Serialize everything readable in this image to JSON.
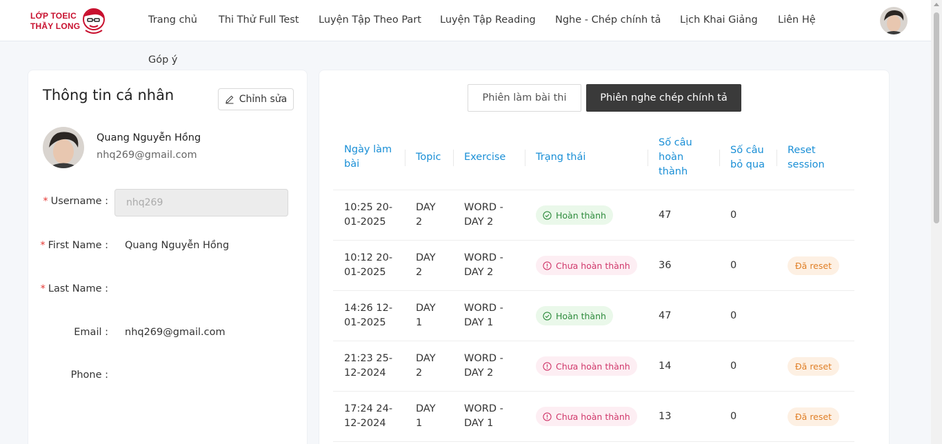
{
  "header": {
    "logo_text_line1": "LỚP TOEIC",
    "logo_text_line2": "THẦY LONG",
    "nav": [
      "Trang chủ",
      "Thi Thử Full Test",
      "Luyện Tập Theo Part",
      "Luyện Tập Reading",
      "Nghe - Chép chính tả",
      "Lịch Khai Giảng",
      "Liên Hệ",
      "Góp ý"
    ],
    "avatar_icon": "user-avatar"
  },
  "profile": {
    "title": "Thông tin cá nhân",
    "edit_label": "Chỉnh sửa",
    "edit_icon": "pencil-icon",
    "name": "Quang Nguyễn Hồng",
    "email": "nhq269@gmail.com",
    "fields": {
      "username_label": "Username",
      "username_value": "nhq269",
      "first_name_label": "First Name",
      "first_name_value": "Quang Nguyễn Hồng",
      "last_name_label": "Last Name",
      "last_name_value": "",
      "email_label": "Email",
      "email_value": "nhq269@gmail.com",
      "phone_label": "Phone",
      "phone_value": ""
    }
  },
  "tabs": {
    "tab1": "Phiên làm bài thi",
    "tab2": "Phiên nghe chép chính tả",
    "active": "tab2"
  },
  "table": {
    "columns": {
      "date": [
        "Ngày làm",
        "bài"
      ],
      "topic": [
        "Topic"
      ],
      "exercise": [
        "Exercise"
      ],
      "status": [
        "Trạng thái"
      ],
      "completed": [
        "Số câu",
        "hoàn",
        "thành"
      ],
      "skipped": [
        "Số câu",
        "bỏ qua"
      ],
      "reset": [
        "Reset",
        "session"
      ]
    },
    "rows": [
      {
        "date": [
          "10:25 20-",
          "01-2025"
        ],
        "topic": [
          "DAY",
          "2"
        ],
        "exercise": [
          "WORD -",
          "DAY 2"
        ],
        "status": "Hoàn thành",
        "status_type": "ok",
        "completed": "47",
        "skipped": "0",
        "reset": ""
      },
      {
        "date": [
          "10:12 20-",
          "01-2025"
        ],
        "topic": [
          "DAY",
          "2"
        ],
        "exercise": [
          "WORD -",
          "DAY 2"
        ],
        "status": "Chưa hoàn thành",
        "status_type": "warn",
        "completed": "36",
        "skipped": "0",
        "reset": "Đã reset"
      },
      {
        "date": [
          "14:26 12-",
          "01-2025"
        ],
        "topic": [
          "DAY",
          "1"
        ],
        "exercise": [
          "WORD -",
          "DAY 1"
        ],
        "status": "Hoàn thành",
        "status_type": "ok",
        "completed": "47",
        "skipped": "0",
        "reset": ""
      },
      {
        "date": [
          "21:23 25-",
          "12-2024"
        ],
        "topic": [
          "DAY",
          "2"
        ],
        "exercise": [
          "WORD -",
          "DAY 2"
        ],
        "status": "Chưa hoàn thành",
        "status_type": "warn",
        "completed": "14",
        "skipped": "0",
        "reset": "Đã reset"
      },
      {
        "date": [
          "17:24 24-",
          "12-2024"
        ],
        "topic": [
          "DAY",
          "1"
        ],
        "exercise": [
          "WORD -",
          "DAY 1"
        ],
        "status": "Chưa hoàn thành",
        "status_type": "warn",
        "completed": "13",
        "skipped": "0",
        "reset": "Đã reset"
      }
    ]
  },
  "colors": {
    "accent_blue": "#1a8fd6",
    "success_bg": "#eaf8ea",
    "success_text": "#2e8b3d",
    "warn_bg": "#fdeef3",
    "warn_text": "#d0386b",
    "reset_bg": "#fdf0e3",
    "reset_text": "#e07f26",
    "active_tab_bg": "#3a3a3a"
  }
}
